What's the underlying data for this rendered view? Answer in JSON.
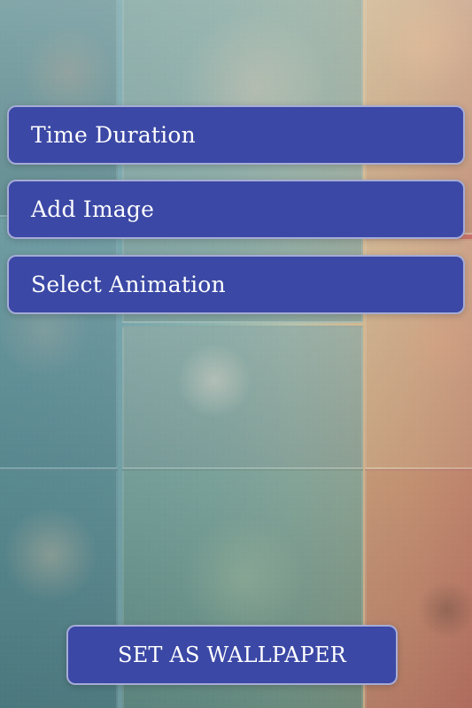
{
  "menu": {
    "items": [
      {
        "label": "Time Duration"
      },
      {
        "label": "Add Image"
      },
      {
        "label": "Select Animation"
      }
    ]
  },
  "actions": {
    "set_wallpaper": "SET AS WALLPAPER"
  },
  "colors": {
    "button_fill": "#3b48a5",
    "button_text": "#ffffff",
    "button_border": "rgba(255,255,255,0.55)"
  }
}
